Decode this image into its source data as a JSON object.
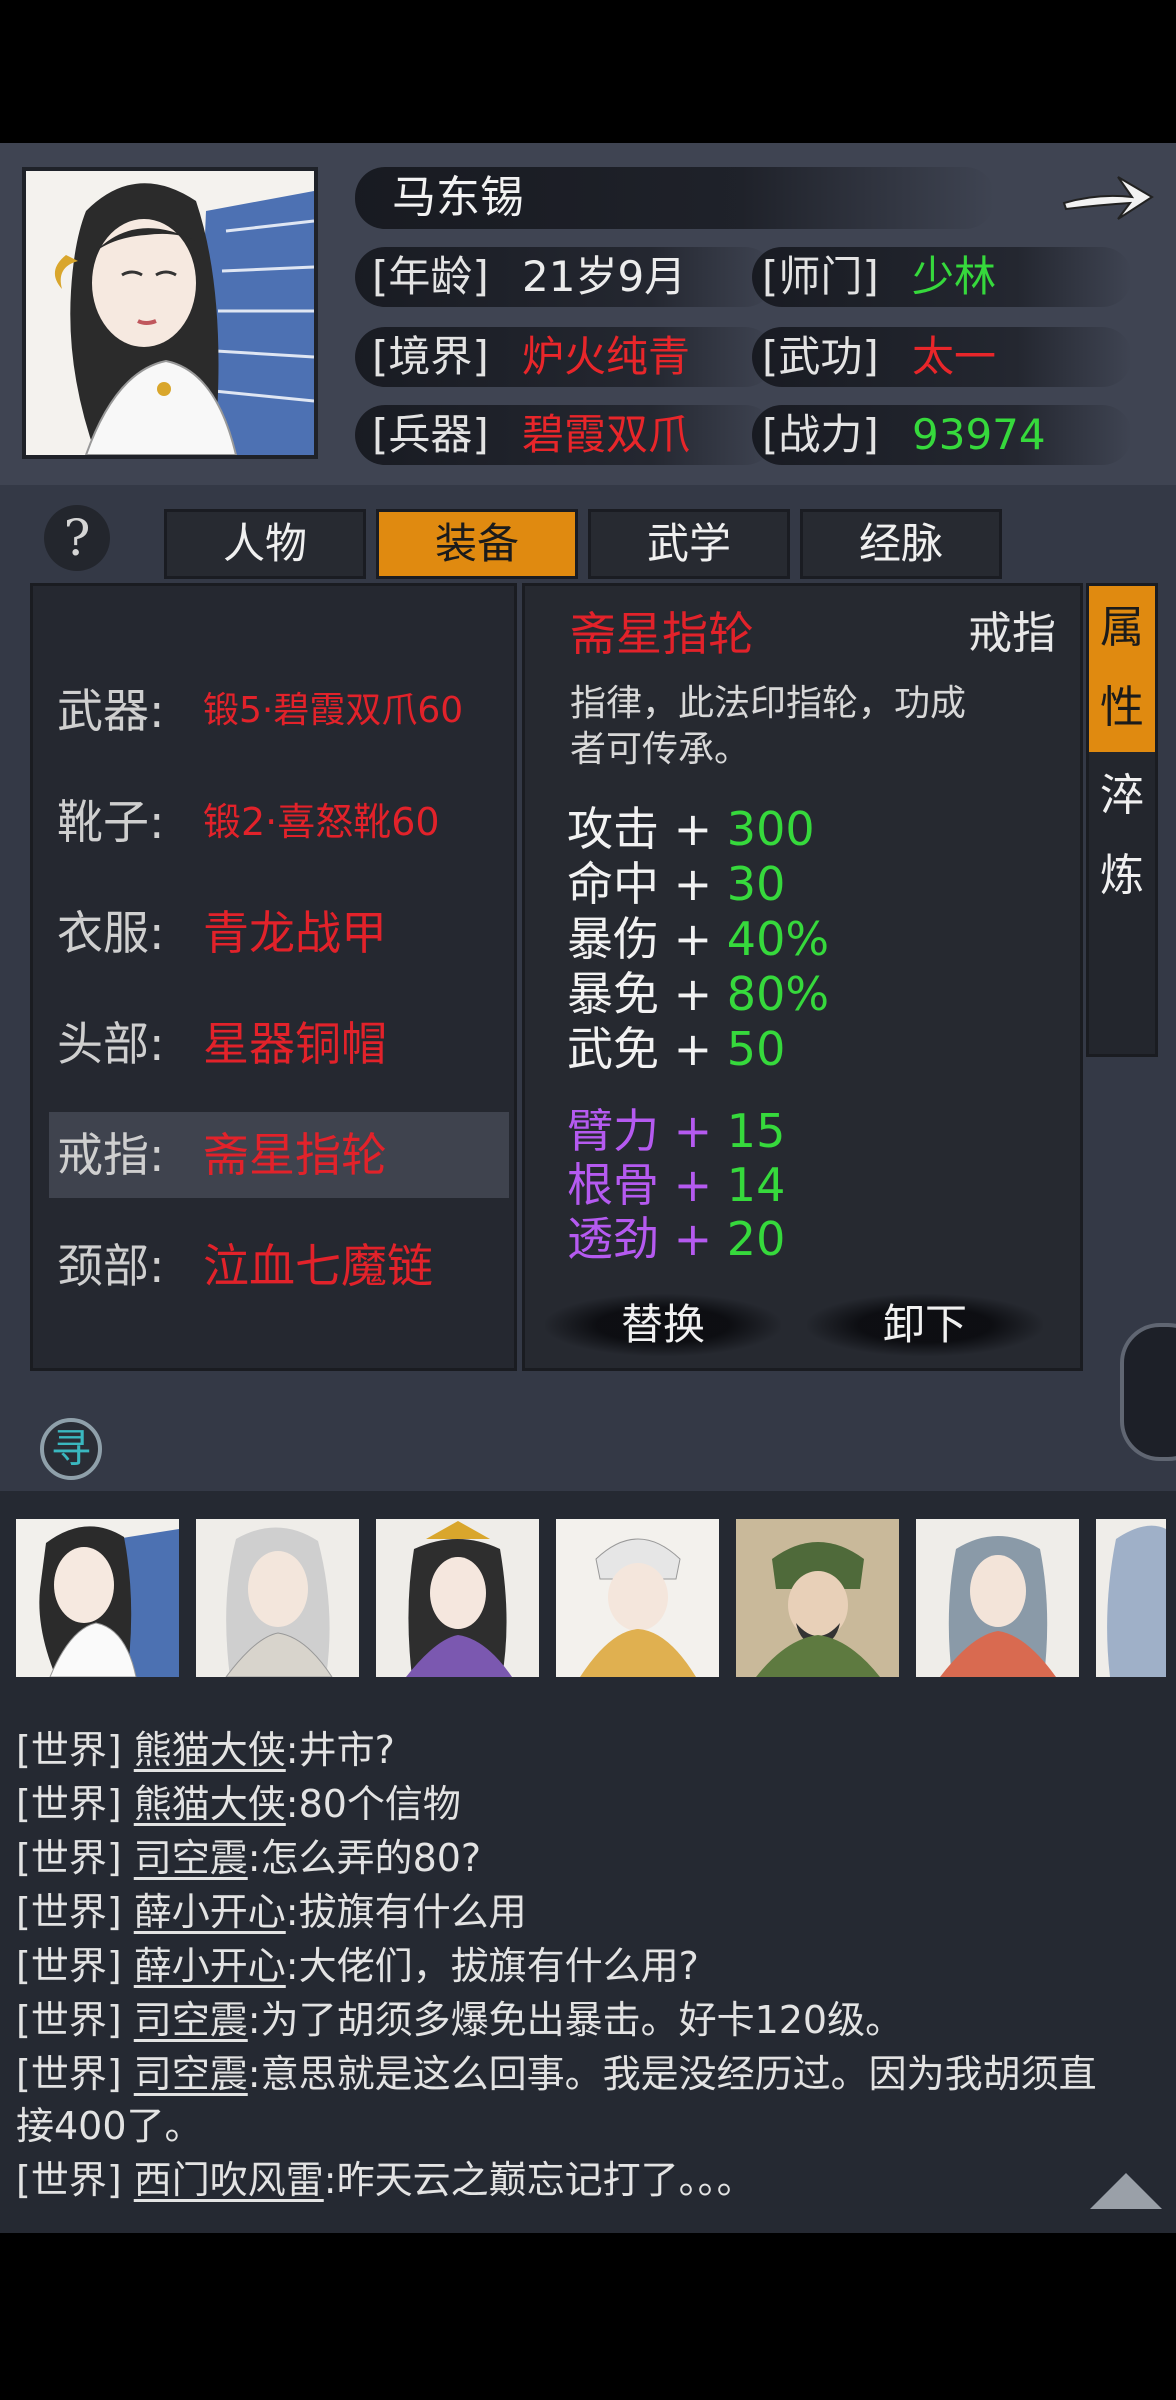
{
  "header": {
    "name": "马东锡",
    "rows": [
      {
        "label": "[年龄]",
        "value": "21岁9月",
        "color": "white"
      },
      {
        "label": "[师门]",
        "value": "少林",
        "color": "green"
      },
      {
        "label": "[境界]",
        "value": "炉火纯青",
        "color": "red"
      },
      {
        "label": "[武功]",
        "value": "太一",
        "color": "red"
      },
      {
        "label": "[兵器]",
        "value": "碧霞双爪",
        "color": "red"
      },
      {
        "label": "[战力]",
        "value": "93974",
        "color": "green"
      }
    ]
  },
  "help": "?",
  "tabs": [
    "人物",
    "装备",
    "武学",
    "经脉"
  ],
  "active_tab": "装备",
  "equipment": [
    {
      "slot": "武器:",
      "item": "锻5·碧霞双爪60"
    },
    {
      "slot": "靴子:",
      "item": "锻2·喜怒靴60"
    },
    {
      "slot": "衣服:",
      "item": "青龙战甲"
    },
    {
      "slot": "头部:",
      "item": "星器铜帽"
    },
    {
      "slot": "戒指:",
      "item": "斋星指轮"
    },
    {
      "slot": "颈部:",
      "item": "泣血七魔链"
    }
  ],
  "detail": {
    "name": "斋星指轮",
    "type": "戒指",
    "desc": [
      "指律，此法印指轮，功成",
      "者可传承。"
    ],
    "stats": [
      {
        "k": "攻击",
        "v": "300"
      },
      {
        "k": "命中",
        "v": "30"
      },
      {
        "k": "暴伤",
        "v": "40%"
      },
      {
        "k": "暴免",
        "v": "80%"
      },
      {
        "k": "武免",
        "v": "50"
      }
    ],
    "bonus": [
      {
        "k": "臂力",
        "v": "15"
      },
      {
        "k": "根骨",
        "v": "14"
      },
      {
        "k": "透劲",
        "v": "20"
      }
    ],
    "plus": "+",
    "replace": "替换",
    "unequip": "卸下"
  },
  "side_tabs": [
    {
      "c1": "属",
      "c2": "性"
    },
    {
      "c1": "淬",
      "c2": "炼"
    }
  ],
  "xun": "寻",
  "chat": [
    {
      "ch": "[世界]",
      "user": "熊猫大侠",
      "msg": ":井市?"
    },
    {
      "ch": "[世界]",
      "user": "熊猫大侠",
      "msg": ":80个信物"
    },
    {
      "ch": "[世界]",
      "user": "司空震",
      "msg": ":怎么弄的80?"
    },
    {
      "ch": "[世界]",
      "user": "薛小开心",
      "msg": ":拔旗有什么用"
    },
    {
      "ch": "[世界]",
      "user": "薛小开心",
      "msg": ":大佬们，拔旗有什么用?"
    },
    {
      "ch": "[世界]",
      "user": "司空震",
      "msg": ":为了胡须多爆免出暴击。好卡120级。"
    },
    {
      "ch": "[世界]",
      "user": "司空震",
      "msg": ":意思就是这么回事。我是没经历过。因为我胡须直"
    },
    {
      "ch": "",
      "user": "",
      "msg": "接400了。"
    },
    {
      "ch": "[世界]",
      "user": "西门吹风雷",
      "msg": ":昨天云之巅忘记打了。。。"
    }
  ]
}
